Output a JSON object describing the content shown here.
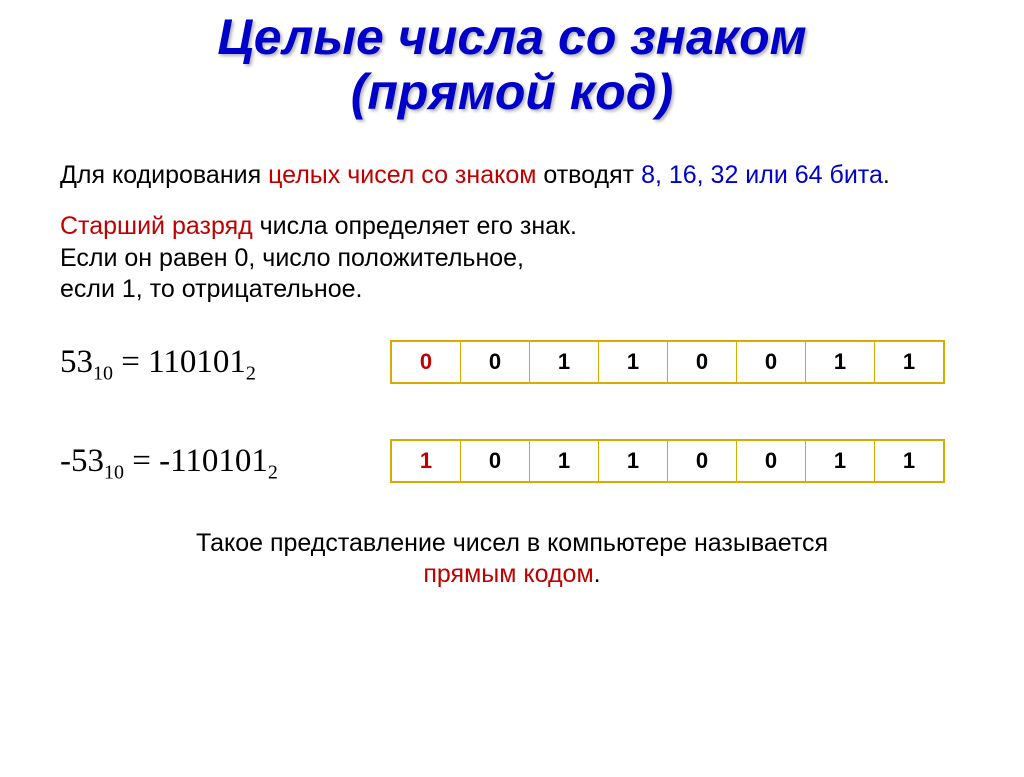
{
  "title": {
    "line1": "Целые числа со знаком",
    "line2": "(прямой код)"
  },
  "para1": {
    "t1": "Для кодирования ",
    "t2": "целых чисел со знаком",
    "t3": " отводят ",
    "t4": "8, 16, 32 или 64 бита",
    "t5": "."
  },
  "para2": {
    "t1": "Старший разряд",
    "t2": " числа определяет его знак.",
    "t3": "Если он равен 0, число положительное,",
    "t4": "если 1, то отрицательное."
  },
  "example1": {
    "num": "53",
    "sub1": "10",
    "eq": " = 110101",
    "sub2": "2",
    "bits": [
      "0",
      "0",
      "1",
      "1",
      "0",
      "0",
      "1",
      "1"
    ]
  },
  "example2": {
    "num": "-53",
    "sub1": "10",
    "eq": " = -110101",
    "sub2": "2",
    "bits": [
      "1",
      "0",
      "1",
      "1",
      "0",
      "0",
      "1",
      "1"
    ]
  },
  "footer": {
    "t1": "Такое представление чисел в компьютере называется",
    "t2": "прямым кодом",
    "t3": "."
  }
}
